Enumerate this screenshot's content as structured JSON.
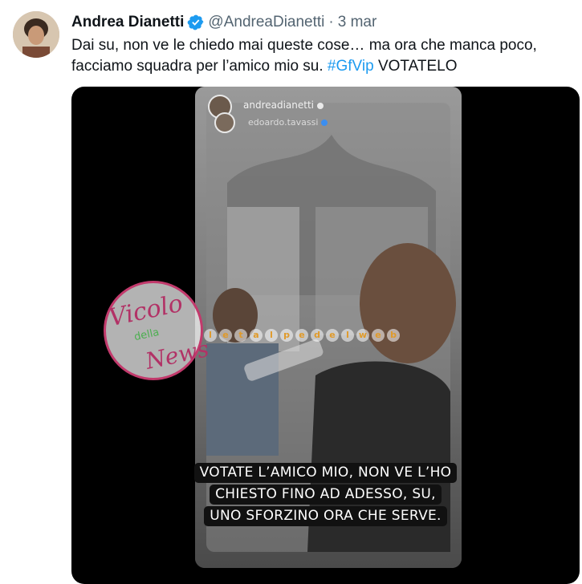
{
  "tweet": {
    "author": {
      "display_name": "Andrea Dianetti",
      "handle": "@AndreaDianetti",
      "verified": true
    },
    "separator": "·",
    "timestamp": "3 mar",
    "text_line1": "Dai su, non ve le chiedo mai queste cose… ma ora che manca poco,",
    "text_line2_prefix": "facciamo squadra per l’amico mio su. ",
    "hashtag": "#GfVip",
    "text_line2_suffix": " VOTATELO"
  },
  "media": {
    "story_users": {
      "user1": "andreadianetti",
      "user2": "edoardo.tavassi"
    },
    "caption_lines": [
      "VOTATE L’AMICO MIO, NON VE L’HO",
      "CHIESTO FINO AD ADESSO, SU,",
      "UNO SFORZINO ORA CHE SERVE."
    ],
    "watermark": {
      "line1": "Vicolo",
      "line2": "della",
      "line3": "News"
    },
    "talpe_watermark": [
      "l",
      "e",
      "t",
      "a",
      "l",
      "p",
      "e",
      "d",
      "e",
      "l",
      "w",
      "e",
      "b"
    ]
  },
  "colors": {
    "link": "#1d9bf0",
    "text": "#0f1419",
    "secondary": "#536471",
    "verified": "#1d9bf0"
  },
  "icons": {
    "verified": "verified-badge-icon"
  }
}
